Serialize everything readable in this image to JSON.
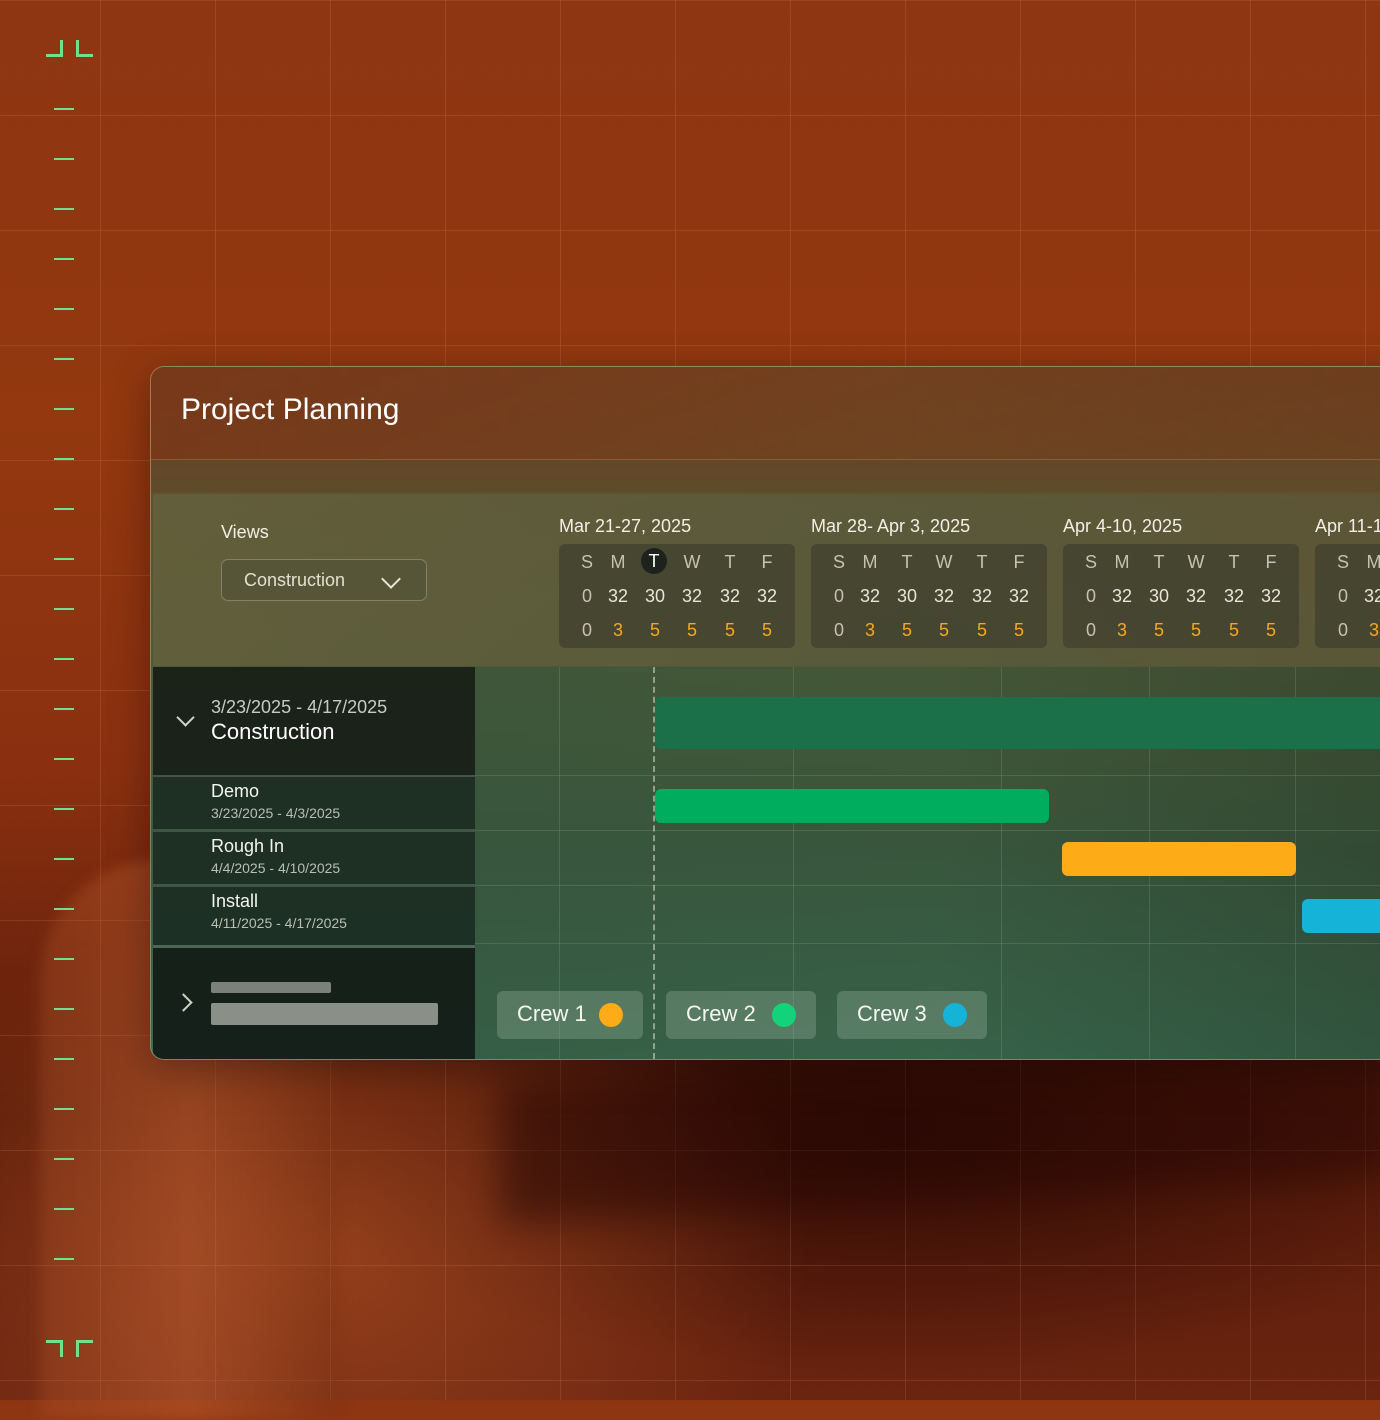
{
  "app": {
    "title": "Project Planning"
  },
  "toolbar": {
    "views_label": "Views",
    "view_selected": "Construction"
  },
  "weeks": [
    {
      "label": "Mar 21-27, 2025",
      "days": [
        "S",
        "M",
        "T",
        "W",
        "T",
        "F"
      ],
      "hours": [
        "0",
        "32",
        "30",
        "32",
        "32",
        "32"
      ],
      "crews": [
        "0",
        "3",
        "5",
        "5",
        "5",
        "5"
      ],
      "today_index": 2
    },
    {
      "label": "Mar 28- Apr 3, 2025",
      "days": [
        "S",
        "M",
        "T",
        "W",
        "T",
        "F"
      ],
      "hours": [
        "0",
        "32",
        "30",
        "32",
        "32",
        "32"
      ],
      "crews": [
        "0",
        "3",
        "5",
        "5",
        "5",
        "5"
      ]
    },
    {
      "label": "Apr 4-10, 2025",
      "days": [
        "S",
        "M",
        "T",
        "W",
        "T",
        "F"
      ],
      "hours": [
        "0",
        "32",
        "30",
        "32",
        "32",
        "32"
      ],
      "crews": [
        "0",
        "3",
        "5",
        "5",
        "5",
        "5"
      ]
    },
    {
      "label": "Apr 11-1",
      "days": [
        "S",
        "M"
      ],
      "hours": [
        "0",
        "32"
      ],
      "crews": [
        "0",
        "3"
      ]
    }
  ],
  "groups": [
    {
      "name": "Construction",
      "dates": "3/23/2025 - 4/17/2025",
      "expanded": true,
      "tasks": [
        {
          "name": "Demo",
          "dates": "3/23/2025 - 4/3/2025",
          "color": "#00ad5f"
        },
        {
          "name": "Rough In",
          "dates": "4/4/2025 - 4/10/2025",
          "color": "#fdab17"
        },
        {
          "name": "Install",
          "dates": "4/11/2025 - 4/17/2025",
          "color": "#15b3d8"
        }
      ]
    }
  ],
  "crews": [
    {
      "label": "Crew 1",
      "color": "#fdab17"
    },
    {
      "label": "Crew 2",
      "color": "#13d37a"
    },
    {
      "label": "Crew 3",
      "color": "#15b3d8"
    }
  ],
  "colors": {
    "accent_green": "#6fe08f",
    "group_bar": "#1b7049",
    "background": "#8e3512"
  }
}
